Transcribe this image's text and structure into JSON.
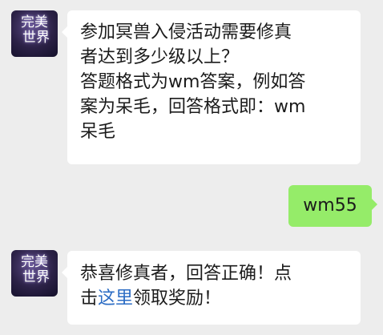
{
  "chat": {
    "bot_avatar_text_line1": "完美",
    "bot_avatar_text_line2": "世界",
    "question": {
      "line1": "参加冥兽入侵活动需要修真",
      "line2": "者达到多少级以上？",
      "line3": "答题格式为wm答案，例如答",
      "line4": "案为呆毛，回答格式即：wm",
      "line5": "呆毛"
    },
    "user_reply": "wm55",
    "answer": {
      "line1": "恭喜修真者，回答正确！点",
      "line2_prefix": "击",
      "link_text": "这里",
      "line2_suffix": "领取奖励！"
    }
  },
  "colors": {
    "background": "#ededed",
    "incoming_bubble": "#ffffff",
    "outgoing_bubble": "#95ec69",
    "link": "#2b6cc4"
  }
}
